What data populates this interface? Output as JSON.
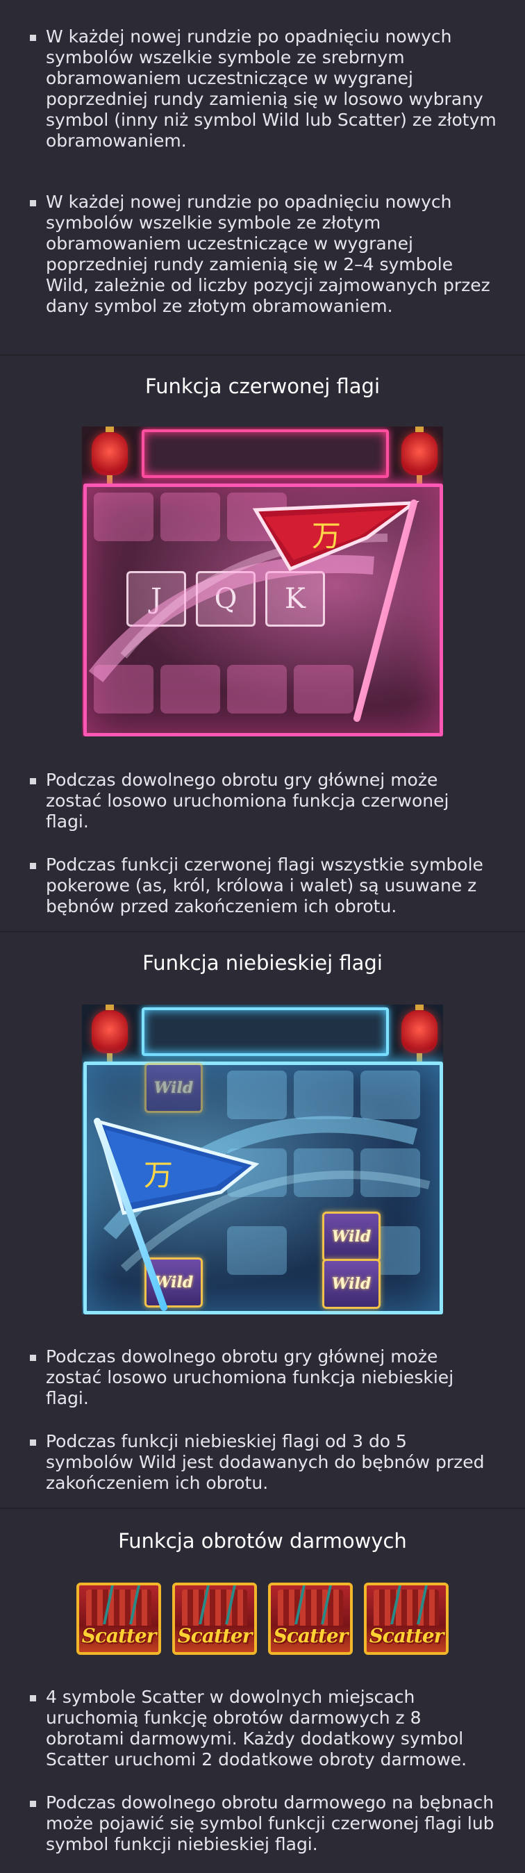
{
  "intro": {
    "bullets": [
      "W każdej nowej rundzie po opadnięciu nowych symbolów wszelkie symbole ze srebrnym obramowaniem uczestniczące w wygranej poprzedniej rundy zamienią się w losowo wybrany symbol (inny niż symbol Wild lub Scatter) ze złotym obramowaniem.",
      "W każdej nowej rundzie po opadnięciu nowych symbolów wszelkie symbole ze złotym obramowaniem uczestniczące w wygranej poprzedniej rundy zamienią się w 2–4 symbole Wild, zależnie od liczby pozycji zajmowanych przez dany symbol ze złotym obramowaniem."
    ]
  },
  "red_flag": {
    "title": "Funkcja czerwonej flagi",
    "tile_letters": [
      "J",
      "Q",
      "K"
    ],
    "flag_glyph": "万",
    "bullets": [
      "Podczas dowolnego obrotu gry głównej może zostać losowo uruchomiona funkcja czerwonej flagi.",
      "Podczas funkcji czerwonej flagi wszystkie symbole pokerowe (as, król, królowa i walet) są usuwane z bębnów przed zakończeniem ich obrotu."
    ]
  },
  "blue_flag": {
    "title": "Funkcja niebieskiej flagi",
    "wild_label": "Wild",
    "flag_glyph": "万",
    "bullets": [
      "Podczas dowolnego obrotu gry głównej może zostać losowo uruchomiona funkcja niebieskiej flagi.",
      "Podczas funkcji niebieskiej flagi od 3 do 5 symbolów Wild jest dodawanych do bębnów przed zakończeniem ich obrotu."
    ]
  },
  "free_spins": {
    "title": "Funkcja obrotów darmowych",
    "scatter_label": "Scatter",
    "bullets": [
      "4 symbole Scatter w dowolnych miejscach uruchomią funkcję obrotów darmowych z 8 obrotami darmowymi. Każdy dodatkowy symbol Scatter uruchomi 2 dodatkowe obroty darmowe.",
      "Podczas dowolnego obrotu darmowego na bębnach może pojawić się symbol funkcji czerwonej flagi lub symbol funkcji niebieskiej flagi."
    ]
  },
  "colors": {
    "background": "#2b2a35",
    "text": "#e6e6ec",
    "red_glow": "#ff58b4",
    "blue_glow": "#8fe6ff",
    "gold": "#f2b62a"
  }
}
